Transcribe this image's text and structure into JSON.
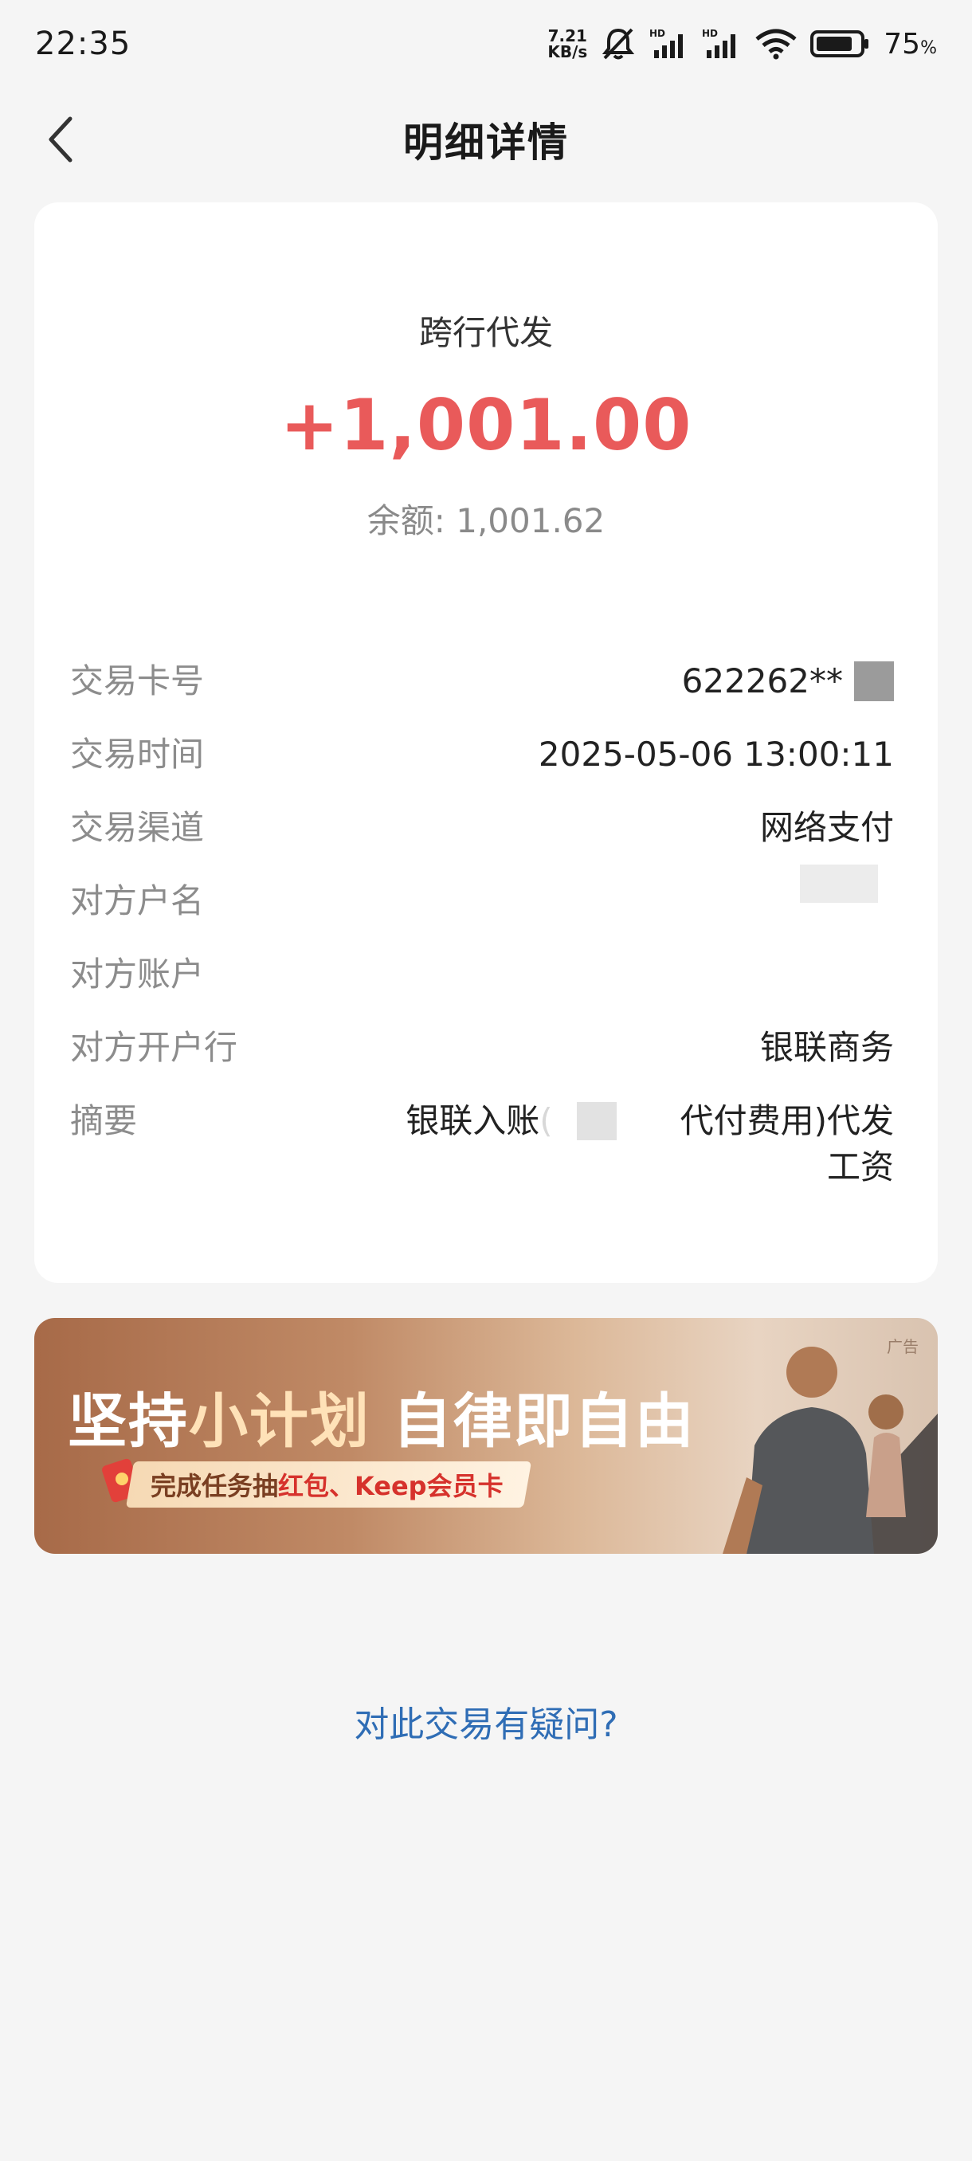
{
  "status_bar": {
    "time": "22:35",
    "net_speed_value": "7.21",
    "net_speed_unit": "KB/s",
    "battery_percent": "75",
    "battery_unit": "%"
  },
  "header": {
    "title": "明细详情"
  },
  "transaction": {
    "type": "跨行代发",
    "amount": "+1,001.00",
    "balance": "余额: 1,001.62",
    "amount_color": "#e95a5a"
  },
  "details": {
    "card_label": "交易卡号",
    "card_value": "622262**",
    "time_label": "交易时间",
    "time_value": "2025-05-06 13:00:11",
    "channel_label": "交易渠道",
    "channel_value": "网络支付",
    "counterparty_name_label": "对方户名",
    "counterparty_account_label": "对方账户",
    "counterparty_bank_label": "对方开户行",
    "counterparty_bank_value": "银联商务",
    "summary_label": "摘要",
    "summary_part1": "银联入账",
    "summary_open_paren": "(",
    "summary_part2": "代付费用)代发",
    "summary_part3": "工资"
  },
  "ad": {
    "tag": "广告",
    "headline_part1": "坚持",
    "headline_accent": "小计划",
    "headline_part2": " 自律即自由",
    "sub_part1": "完成任务抽",
    "sub_red": "红包、Keep会员卡"
  },
  "help": {
    "link_text": "对此交易有疑问?"
  },
  "colors": {
    "background": "#f5f5f5",
    "link": "#2f6db5",
    "label": "#8c8c8c"
  }
}
